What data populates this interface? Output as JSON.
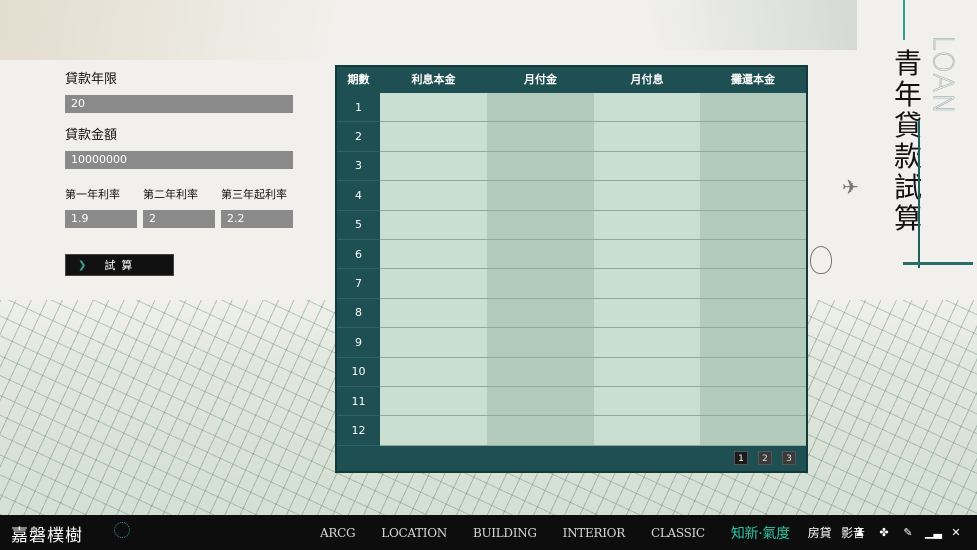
{
  "form": {
    "years_label": "貸款年限",
    "years_value": "20",
    "amount_label": "貸款金額",
    "amount_value": "10000000",
    "rate1_label": "第一年利率",
    "rate1_value": "1.9",
    "rate2_label": "第二年利率",
    "rate2_value": "2",
    "rate3_label": "第三年起利率",
    "rate3_value": "2.2",
    "calc_label": "試算"
  },
  "table": {
    "headers": [
      "期數",
      "利息本金",
      "月付金",
      "月付息",
      "攤還本金"
    ],
    "rows": [
      "1",
      "2",
      "3",
      "4",
      "5",
      "6",
      "7",
      "8",
      "9",
      "10",
      "11",
      "12"
    ],
    "pages": [
      "1",
      "2",
      "3"
    ]
  },
  "side": {
    "title": "青年貸款試算",
    "subtitle": "LOAN"
  },
  "footer": {
    "logo": "嘉磐樸樹",
    "nav": [
      "ARCG",
      "LOCATION",
      "BUILDING",
      "INTERIOR",
      "CLASSIC"
    ],
    "accent": "知新·氣度",
    "cn_items": [
      "房貸",
      "影音"
    ]
  },
  "colors": {
    "table_header": "#1e4f52",
    "accent": "#2fc3a4"
  },
  "icons": [
    "person-icon",
    "puzzle-icon",
    "link-icon",
    "chart-icon",
    "close-icon"
  ]
}
